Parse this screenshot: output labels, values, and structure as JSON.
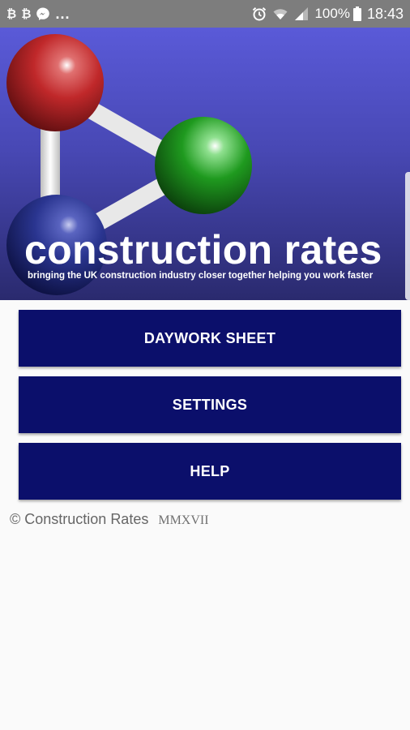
{
  "status_bar": {
    "left_icons": [
      "bitcoin-outline-icon",
      "bitcoin-icon",
      "messenger-icon"
    ],
    "btc_glyph_1": "₿",
    "btc_glyph_2": "₿",
    "overflow": "...",
    "battery_percent": "100%",
    "time": "18:43",
    "right_icons": [
      "alarm-icon",
      "wifi-icon",
      "signal-icon",
      "battery-icon"
    ]
  },
  "banner": {
    "title": "construction rates",
    "tagline": "bringing the UK construction industry closer together helping you work faster",
    "colors": {
      "background_top": "#5a5ad8",
      "background_bottom": "#2a2a6e",
      "atom_red": "#c0282a",
      "atom_green": "#1f9a1f",
      "atom_blue": "#2a3590"
    }
  },
  "menu": {
    "buttons": [
      {
        "label": "DAYWORK SHEET"
      },
      {
        "label": "SETTINGS"
      },
      {
        "label": "HELP"
      }
    ],
    "button_color": "#0b0f6b"
  },
  "footer": {
    "copyright": "© Construction Rates",
    "year": "MMXVII"
  }
}
